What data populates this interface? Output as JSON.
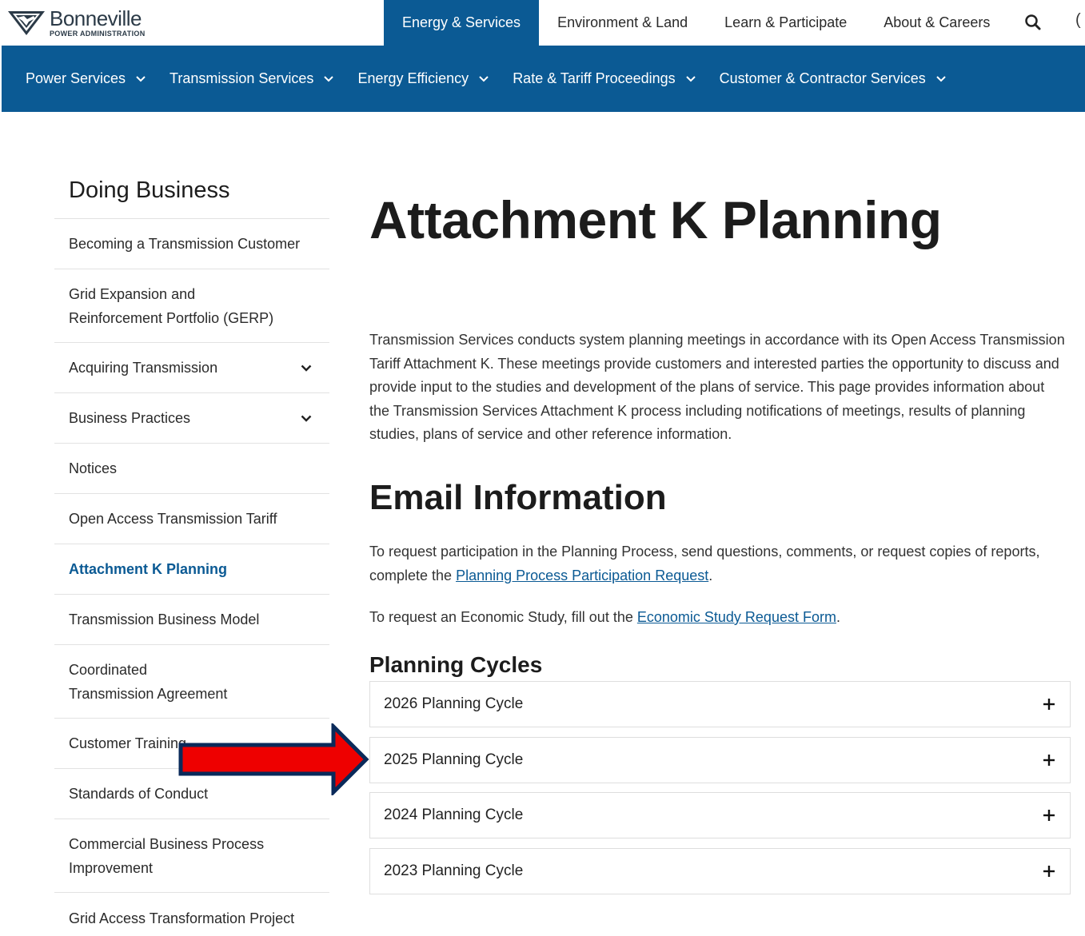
{
  "brand": {
    "name": "Bonneville",
    "subtitle": "POWER ADMINISTRATION"
  },
  "top_nav": [
    {
      "label": "Energy & Services",
      "active": true
    },
    {
      "label": "Environment & Land",
      "active": false
    },
    {
      "label": "Learn & Participate",
      "active": false
    },
    {
      "label": "About & Careers",
      "active": false
    }
  ],
  "search_icon": "search-icon",
  "sub_nav": [
    {
      "label": "Power Services"
    },
    {
      "label": "Transmission Services"
    },
    {
      "label": "Energy Efficiency"
    },
    {
      "label": "Rate & Tariff Proceedings"
    },
    {
      "label": "Customer & Contractor Services"
    }
  ],
  "sidebar": {
    "title": "Doing Business",
    "items": [
      {
        "label": "Becoming a Transmission Customer",
        "expandable": false,
        "active": false
      },
      {
        "label": "Grid Expansion and Reinforcement Portfolio (GERP)",
        "expandable": false,
        "active": false
      },
      {
        "label": "Acquiring Transmission",
        "expandable": true,
        "active": false
      },
      {
        "label": "Business Practices",
        "expandable": true,
        "active": false
      },
      {
        "label": "Notices",
        "expandable": false,
        "active": false
      },
      {
        "label": "Open Access Transmission Tariff",
        "expandable": false,
        "active": false
      },
      {
        "label": "Attachment K Planning",
        "expandable": false,
        "active": true
      },
      {
        "label": "Transmission Business Model",
        "expandable": false,
        "active": false
      },
      {
        "label": "Coordinated Transmission Agreement",
        "expandable": false,
        "active": false
      },
      {
        "label": "Customer Training",
        "expandable": false,
        "active": false
      },
      {
        "label": "Standards of Conduct",
        "expandable": false,
        "active": false
      },
      {
        "label": "Commercial Business Process Improvement",
        "expandable": false,
        "active": false
      },
      {
        "label": "Grid Access Transformation Project",
        "expandable": false,
        "active": false
      }
    ]
  },
  "main": {
    "title": "Attachment K Planning",
    "intro": "Transmission Services conducts system planning meetings in accordance with its Open Access Transmission Tariff Attachment K. These meetings provide customers and interested parties the opportunity to discuss and provide input to the studies and development of the plans of service. This page provides information about the Transmission Services Attachment K process including notifications of meetings, results of planning studies, plans of service and other reference information.",
    "email_heading": "Email Information",
    "p1_before": "To request participation in the Planning Process, send questions, comments, or request copies of reports, complete the ",
    "p1_link": "Planning Process Participation Request",
    "p1_after": ".",
    "p2_before": "To request an Economic Study, fill out the ",
    "p2_link": "Economic Study Request Form",
    "p2_after": ".",
    "cycles_heading": "Planning Cycles",
    "cycles": [
      {
        "label": "2026 Planning Cycle"
      },
      {
        "label": "2025 Planning Cycle"
      },
      {
        "label": "2024 Planning Cycle"
      },
      {
        "label": "2023 Planning Cycle"
      }
    ]
  },
  "colors": {
    "brand_blue": "#0b5a94",
    "arrow_red": "#ee0000",
    "arrow_outline": "#0a2a5a"
  }
}
